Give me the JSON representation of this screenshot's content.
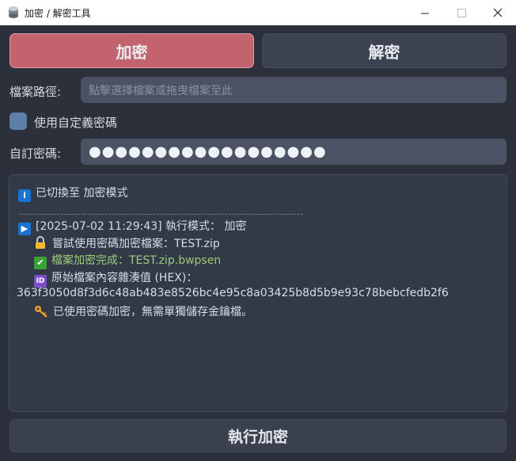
{
  "window": {
    "title": "加密 / 解密工具",
    "minimize": "—",
    "maximize": "☐",
    "close": "✕"
  },
  "modes": {
    "encrypt_label": "加密",
    "decrypt_label": "解密",
    "active": "encrypt"
  },
  "file": {
    "label": "檔案路徑:",
    "placeholder": "點擊選擇檔案或拖曳檔案至此"
  },
  "custom_password": {
    "checkbox_label": "使用自定義密碼",
    "field_label": "自訂密碼:",
    "masked_value": "●●●●●●●●●●●●●●●●●●"
  },
  "log": {
    "mode_switch": "已切換至 加密模式",
    "divider": "-----------------------------------------------------------------------------------",
    "entries": [
      {
        "icon": "play-icon",
        "text": "[2025-07-02 11:29:43] 執行模式： 加密"
      },
      {
        "icon": "lock-icon",
        "text": "嘗試使用密碼加密檔案：TEST.zip"
      },
      {
        "icon": "check-icon",
        "text": "檔案加密完成：TEST.zip.bwpsen"
      },
      {
        "icon": "id-icon",
        "text": "原始檔案內容雜湊值 (HEX)："
      },
      {
        "icon": "",
        "text": "363f3050d8f3d6c48ab483e8526bc4e95c8a03425b8d5b9e93c78bebcfedb2f6"
      },
      {
        "icon": "key-icon",
        "text": "已使用密碼加密，無需單獨儲存金鑰檔。"
      }
    ]
  },
  "actions": {
    "run_label": "執行加密"
  },
  "colors": {
    "background": "#2b303b",
    "encrypt_active": "#c2636e",
    "input_bg": "#4a5263",
    "success_text": "#9ccc7a"
  }
}
